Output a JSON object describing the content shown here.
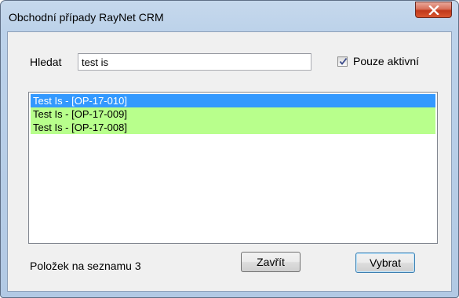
{
  "window": {
    "title": "Obchodní případy RayNet CRM"
  },
  "search": {
    "label": "Hledat",
    "value": "test is"
  },
  "active_only": {
    "label": "Pouze aktivní",
    "checked": true
  },
  "results": [
    {
      "text": "Test Is - [OP-17-010]",
      "state": "selected"
    },
    {
      "text": "Test Is - [OP-17-009]",
      "state": "active"
    },
    {
      "text": "Test Is - [OP-17-008]",
      "state": "active"
    }
  ],
  "footer": {
    "count_label": "Položek na seznamu 3",
    "close_label": "Zavřít",
    "select_label": "Vybrat"
  },
  "colors": {
    "selected_row": "#3399ff",
    "active_row": "#b8ff8c"
  }
}
